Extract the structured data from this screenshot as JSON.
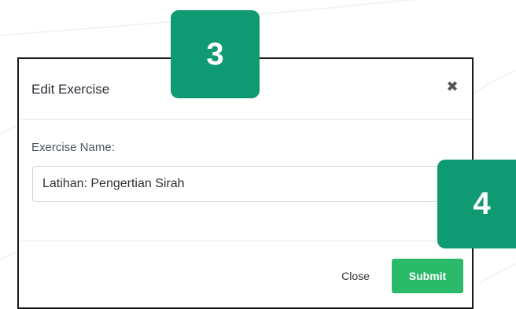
{
  "modal": {
    "title": "Edit Exercise",
    "close_icon_glyph": "✖",
    "field_label": "Exercise Name:",
    "field_value": "Latihan: Pengertian Sirah",
    "close_button": "Close",
    "submit_button": "Submit"
  },
  "badges": {
    "step_3": "3",
    "step_4": "4"
  },
  "colors": {
    "accent_green": "#2bb96a",
    "badge_green": "#0f9a72"
  }
}
